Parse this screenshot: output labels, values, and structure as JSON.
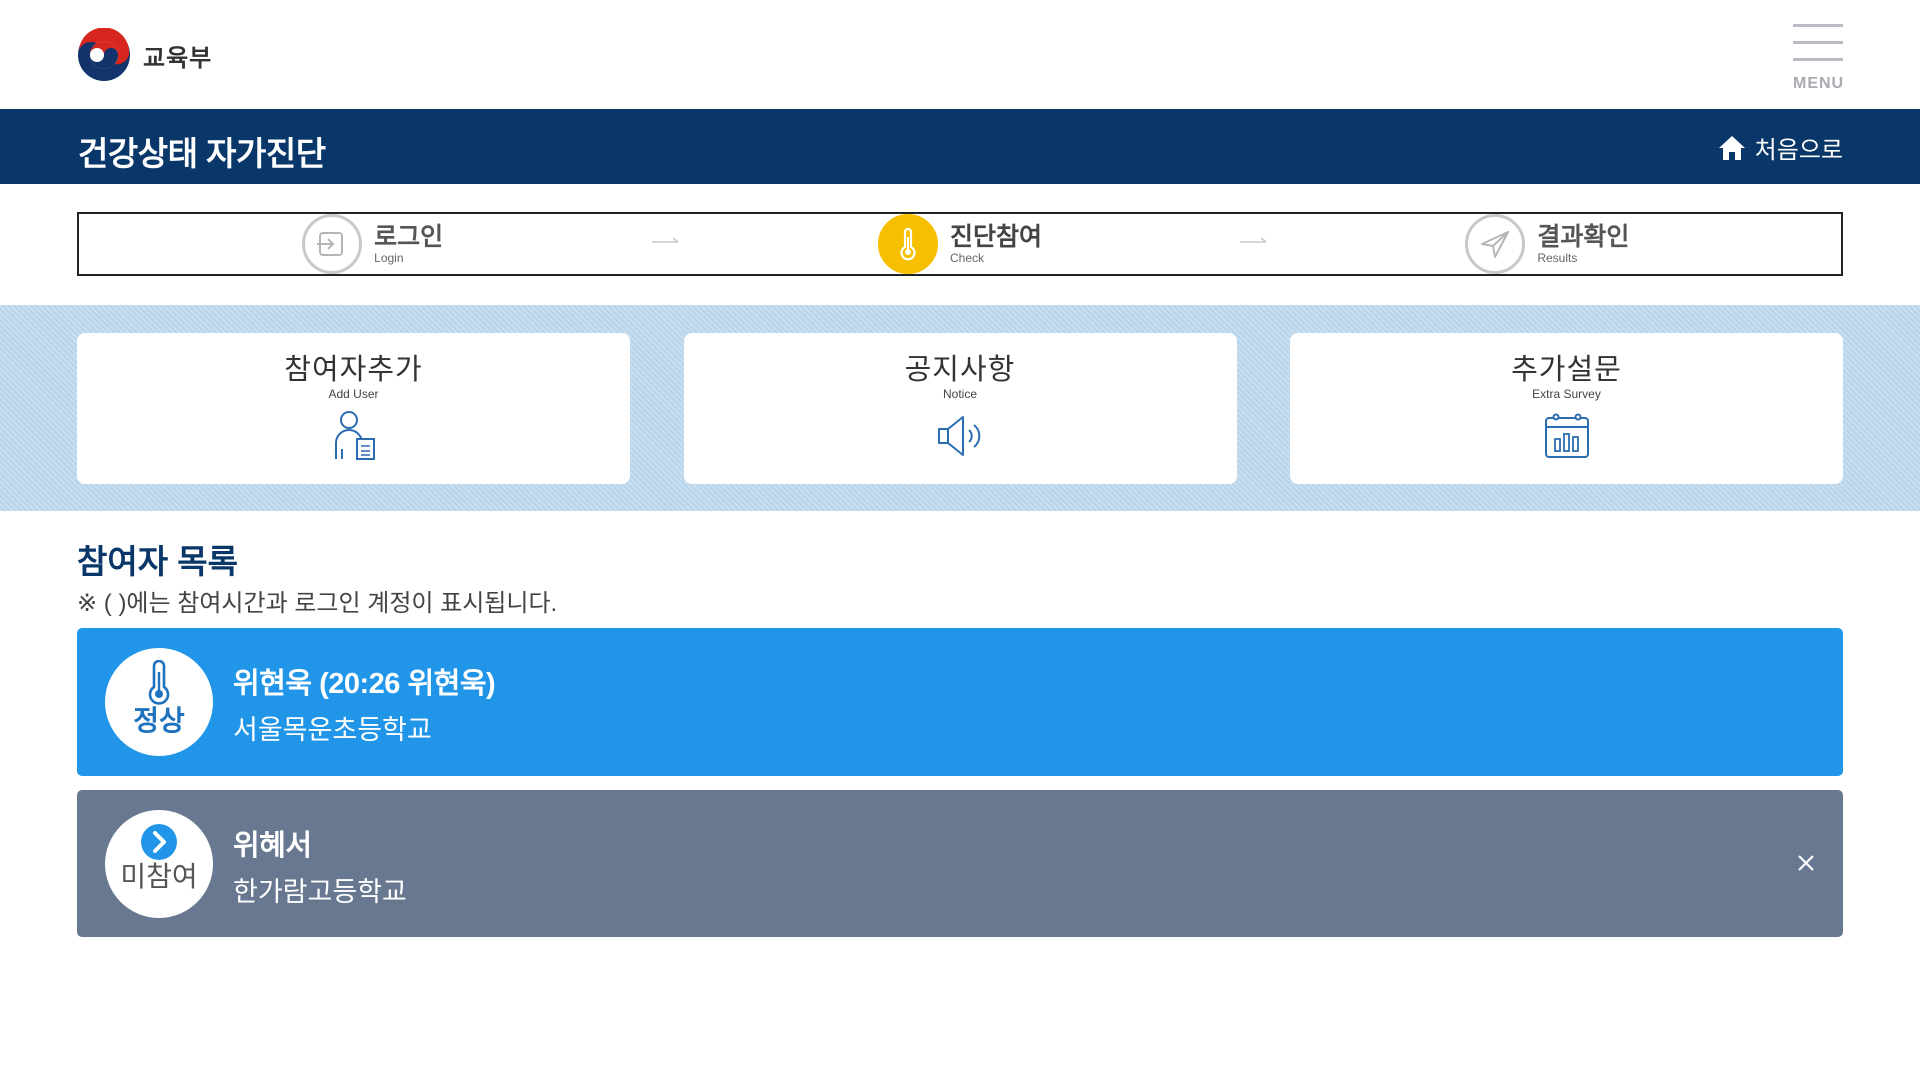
{
  "header": {
    "logo_text": "교육부",
    "menu_label": "MENU"
  },
  "titlebar": {
    "title": "건강상태 자가진단",
    "home_label": "처음으로"
  },
  "steps": [
    {
      "title": "로그인",
      "sub": "Login",
      "icon": "login-icon",
      "active": false
    },
    {
      "title": "진단참여",
      "sub": "Check",
      "icon": "thermometer-icon",
      "active": true
    },
    {
      "title": "결과확인",
      "sub": "Results",
      "icon": "send-icon",
      "active": false
    }
  ],
  "quick_menu": [
    {
      "title": "참여자추가",
      "sub": "Add User",
      "icon": "add-user-icon"
    },
    {
      "title": "공지사항",
      "sub": "Notice",
      "icon": "speaker-icon"
    },
    {
      "title": "추가설문",
      "sub": "Extra Survey",
      "icon": "calendar-chart-icon"
    }
  ],
  "participants": {
    "heading": "참여자 목록",
    "note": "※ ( )에는 참여시간과 로그인 계정이 표시됩니다.",
    "items": [
      {
        "status": "정상",
        "name": "위현욱 (20:26 위현욱)",
        "school": "서울목운초등학교",
        "icon": "thermometer-icon"
      },
      {
        "status": "미참여",
        "name": "위혜서",
        "school": "한가람고등학교",
        "icon": "chevron-right-icon"
      }
    ]
  },
  "colors": {
    "navy": "#0a3769",
    "normal": "#2196e9",
    "pending": "#687890",
    "active_step": "#f6c000",
    "band": "#b7d4eb"
  }
}
